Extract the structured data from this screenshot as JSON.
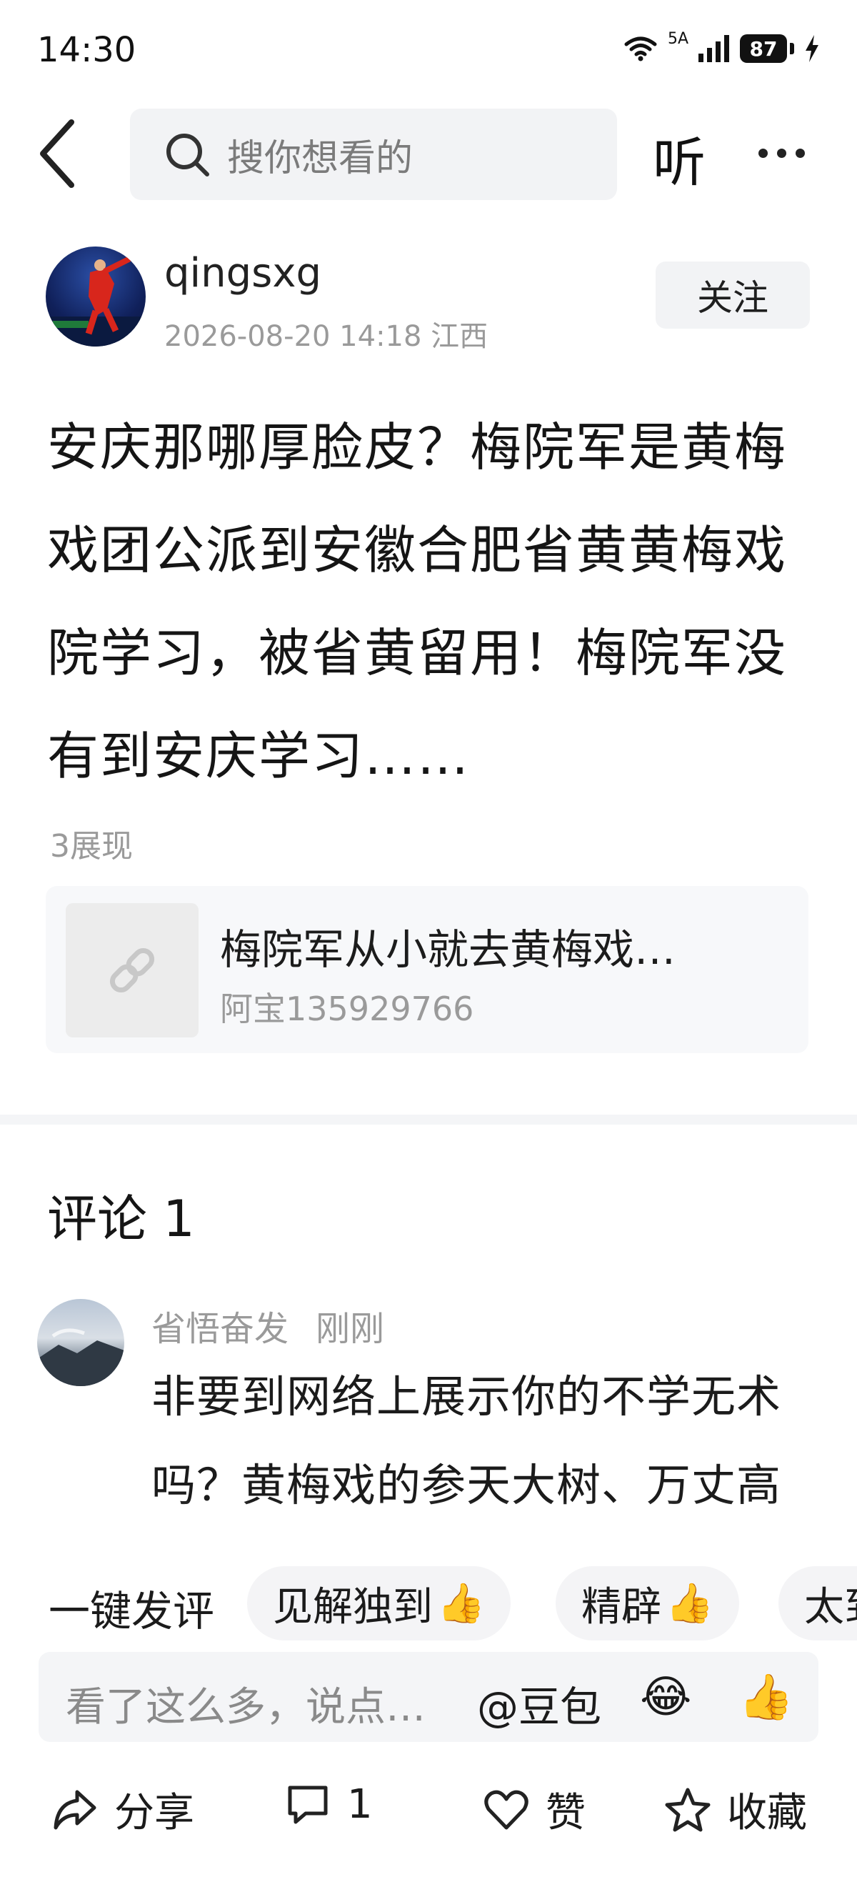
{
  "status_bar": {
    "time": "14:30",
    "network_label": "5A",
    "battery": "87"
  },
  "top_bar": {
    "search_placeholder": "搜你想看的",
    "listen_label": "听"
  },
  "author": {
    "username": "qingsxg",
    "meta": "2026-08-20 14:18 江西",
    "follow_label": "关注"
  },
  "post": {
    "body": "安庆那哪厚脸皮？梅院军是黄梅戏团公派到安徽合肥省黄黄梅戏院学习，被省黄留用！梅院军没有到安庆学习……",
    "views": "3展现"
  },
  "link_card": {
    "title": "梅院军从小就去黄梅戏…",
    "author": "阿宝135929766",
    "icon": "link-icon"
  },
  "comments": {
    "heading": "评论 1",
    "items": [
      {
        "name": "省悟奋发",
        "time": "刚刚",
        "text": "非要到网络上展示你的不学无术吗？黄梅戏的参天大树、万丈高楼都是安庆体系累积起来的！"
      }
    ]
  },
  "quick_comment": {
    "label": "一键发评",
    "chips": [
      "见解独到",
      "精辟",
      "太到"
    ]
  },
  "input_bar": {
    "placeholder": "看了这么多，说点…",
    "mention": "@豆包"
  },
  "actions": {
    "share": "分享",
    "comment_count": "1",
    "like": "赞",
    "favorite": "收藏"
  },
  "colors": {
    "accent_bg": "#f2f3f5",
    "secondary_text": "#9a9a9a"
  }
}
